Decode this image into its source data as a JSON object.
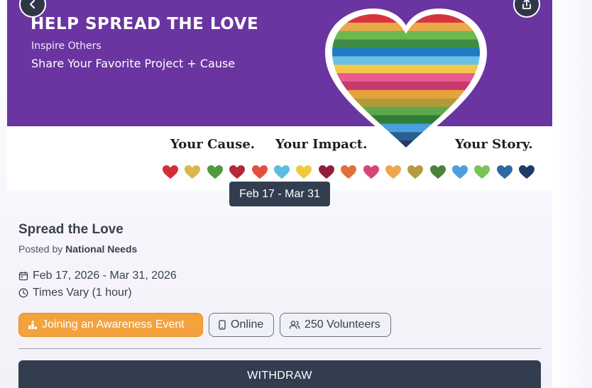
{
  "banner": {
    "heading": "HELP SPREAD THE LOVE",
    "subtitle1": "Inspire Others",
    "subtitle2": "Share Your Favorite Project + Cause",
    "tagline_cause": "Your Cause.",
    "tagline_impact": "Your Impact.",
    "tagline_story": "Your Story.",
    "heart_stripe_colors": [
      "#d8343e",
      "#e9a84a",
      "#6db84f",
      "#3c8c43",
      "#1f7cc1",
      "#6cc0e6",
      "#f2c94c",
      "#e85c90",
      "#c63a6c",
      "#e8a23c",
      "#b09a3a",
      "#5da84a",
      "#2f7d3a",
      "#4aa0dc",
      "#2c5f8f",
      "#1f3b63"
    ],
    "mini_heart_colors": [
      "#d32f3a",
      "#dcb64f",
      "#4f9a3f",
      "#b7273a",
      "#e2513e",
      "#5cbde0",
      "#f0c93d",
      "#8f1f3a",
      "#e0703a",
      "#d6457a",
      "#eca84a",
      "#b69a3e",
      "#4d7f3d",
      "#4f9fdf",
      "#7cc35a",
      "#2e6aa3",
      "#1f3b63"
    ]
  },
  "nav": {
    "back_icon": "chevron-left-icon",
    "share_icon": "share-icon"
  },
  "event": {
    "date_pill": "Feb 17 - Mar 31",
    "title": "Spread the Love",
    "posted_by_prefix": "Posted by",
    "posted_by_org": "National Needs",
    "date_range": "Feb 17, 2026 - Mar 31, 2026",
    "time": "Times Vary (1 hour)",
    "chips": {
      "type": "Joining an Awareness Event",
      "location": "Online",
      "volunteers": "250 Volunteers"
    },
    "withdraw_label": "WITHDRAW"
  },
  "colors": {
    "banner_purple": "#6a35a0",
    "dark_navy": "#323d50",
    "chip_orange": "#f4a23c"
  }
}
